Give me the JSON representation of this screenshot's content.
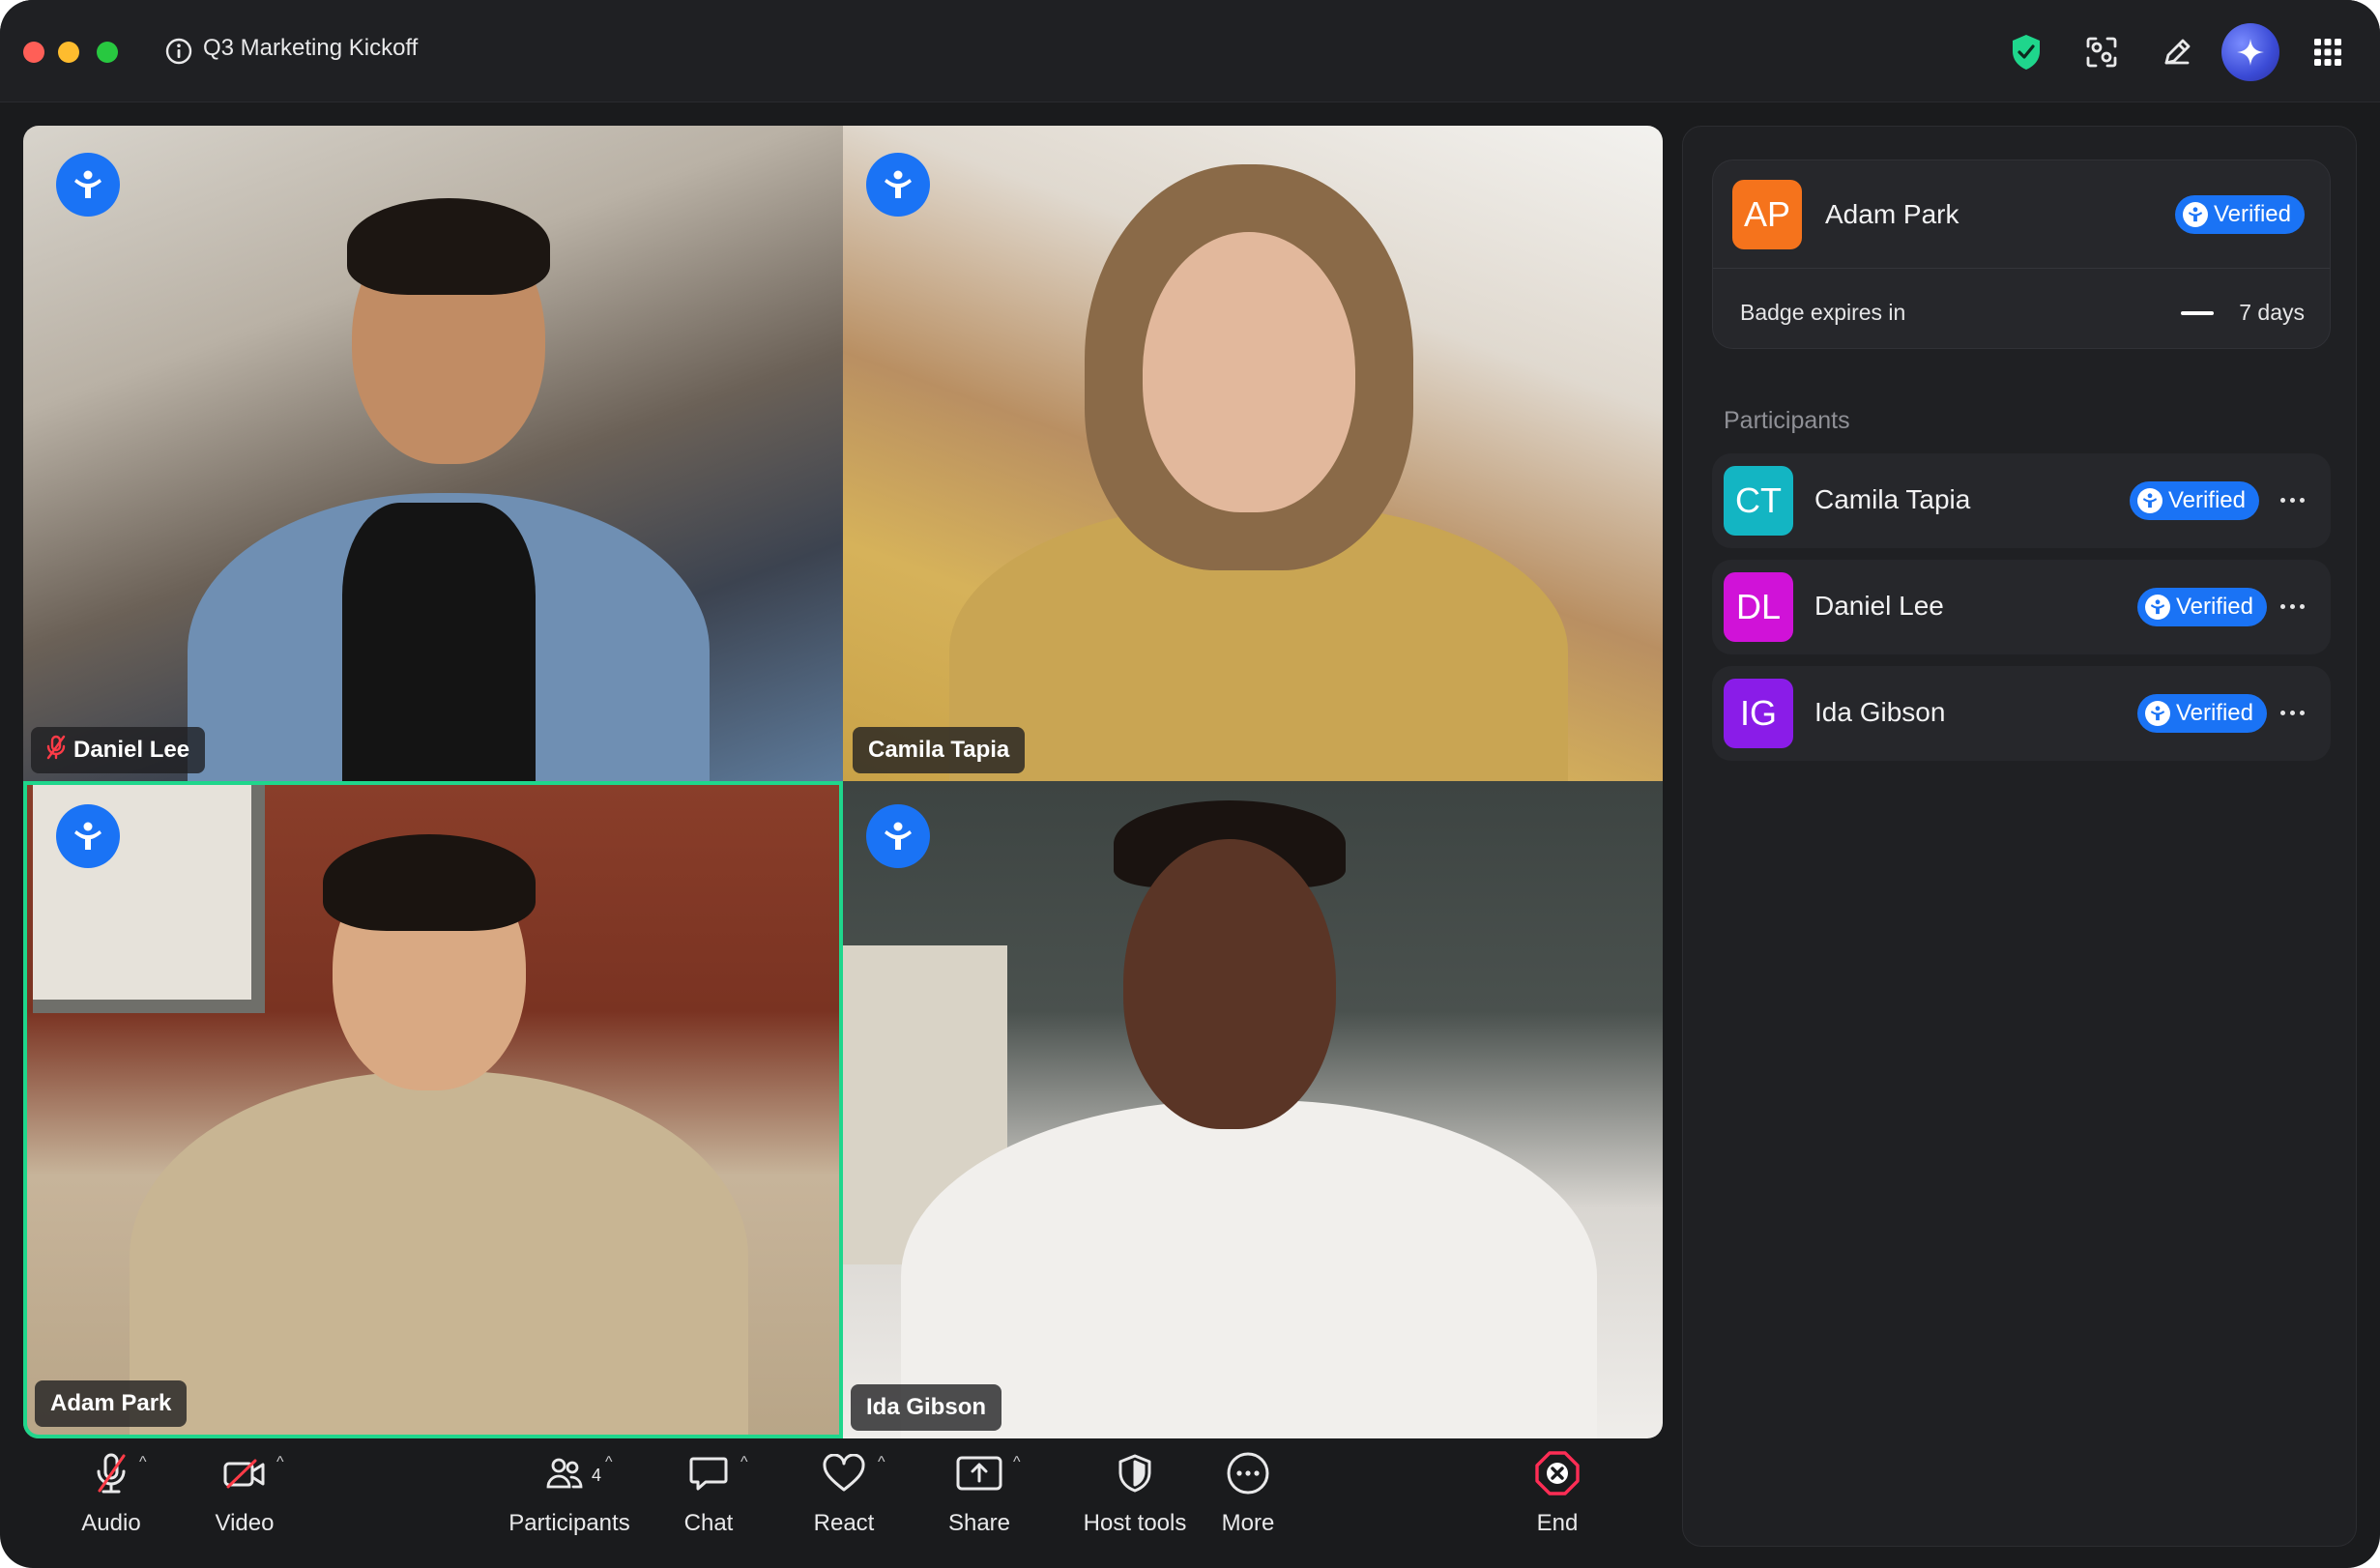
{
  "window": {
    "title": "Q3 Marketing Kickoff"
  },
  "topbar": {
    "icons": [
      "info-icon",
      "shield-check-icon",
      "focus-scan-icon",
      "pencil-icon",
      "ai-sparkle-icon",
      "apps-grid-icon"
    ]
  },
  "tiles": [
    {
      "name": "Daniel Lee",
      "muted": true
    },
    {
      "name": "Camila Tapia",
      "muted": false
    },
    {
      "name": "Adam Park",
      "muted": false,
      "active_speaker": true
    },
    {
      "name": "Ida Gibson",
      "muted": false
    }
  ],
  "sidebar": {
    "me": {
      "initials": "AP",
      "name": "Adam Park",
      "verified_label": "Verified",
      "badge_label": "Badge expires in",
      "badge_value": "7 days",
      "avatar_color": "#f5731c"
    },
    "participants_title": "Participants",
    "participants": [
      {
        "initials": "CT",
        "name": "Camila Tapia",
        "verified_label": "Verified",
        "avatar_color": "#13b5c3"
      },
      {
        "initials": "DL",
        "name": "Daniel Lee",
        "verified_label": "Verified",
        "avatar_color": "#d012d8"
      },
      {
        "initials": "IG",
        "name": "Ida Gibson",
        "verified_label": "Verified",
        "avatar_color": "#8a1ce8"
      }
    ]
  },
  "toolbar": {
    "audio": "Audio",
    "video": "Video",
    "participants": "Participants",
    "participants_count": "4",
    "chat": "Chat",
    "react": "React",
    "share": "Share",
    "host_tools": "Host tools",
    "more": "More",
    "end": "End"
  },
  "colors": {
    "accent": "#1a73f5",
    "active_speaker": "#1fd68c",
    "end": "#ff2d55",
    "shield": "#1fd68c"
  }
}
